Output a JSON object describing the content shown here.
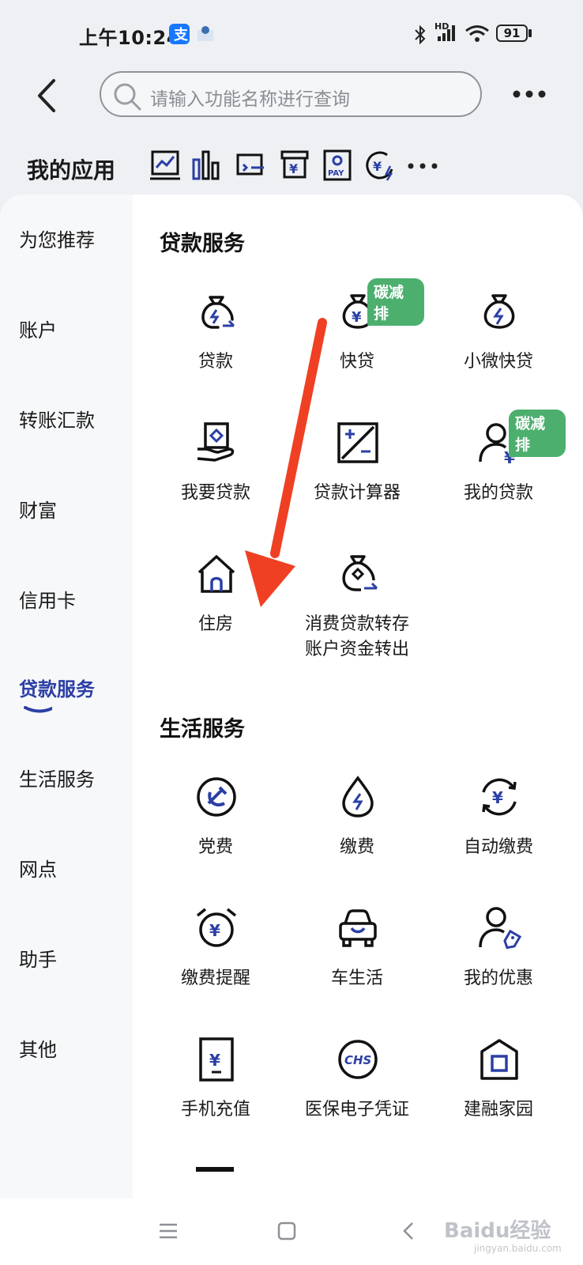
{
  "status_bar": {
    "time": "上午10:24",
    "network": "HD",
    "battery": "91"
  },
  "search": {
    "placeholder": "请输入功能名称进行查询"
  },
  "my_apps": {
    "title": "我的应用",
    "icons": [
      "trend-chart-icon",
      "bar-chart-icon",
      "card-transfer-icon",
      "yuan-box-icon",
      "pay-icon",
      "yuan-refresh-icon",
      "more-dots-icon"
    ]
  },
  "sidebar": {
    "items": [
      {
        "label": "为您推荐"
      },
      {
        "label": "账户"
      },
      {
        "label": "转账汇款"
      },
      {
        "label": "财富"
      },
      {
        "label": "信用卡"
      },
      {
        "label": "贷款服务",
        "active": true
      },
      {
        "label": "生活服务"
      },
      {
        "label": "网点"
      },
      {
        "label": "助手"
      },
      {
        "label": "其他"
      }
    ]
  },
  "sections": [
    {
      "title": "贷款服务",
      "tiles": [
        {
          "label": "贷款",
          "icon": "loan-bag-icon"
        },
        {
          "label": "快贷",
          "icon": "yuan-bag-icon",
          "badge": "碳减排"
        },
        {
          "label": "小微快贷",
          "icon": "lightning-bag-icon"
        },
        {
          "label": "我要贷款",
          "icon": "hand-document-icon"
        },
        {
          "label": "贷款计算器",
          "icon": "calculator-icon"
        },
        {
          "label": "我的贷款",
          "icon": "person-yuan-icon",
          "badge": "碳减排"
        },
        {
          "label": "住房",
          "icon": "house-icon"
        },
        {
          "label_line1": "消费贷款转存",
          "label_line2": "账户资金转出",
          "icon": "bag-transfer-icon"
        }
      ]
    },
    {
      "title": "生活服务",
      "tiles": [
        {
          "label": "党费",
          "icon": "party-emblem-icon"
        },
        {
          "label": "缴费",
          "icon": "water-drop-icon"
        },
        {
          "label": "自动缴费",
          "icon": "yuan-cycle-icon"
        },
        {
          "label": "缴费提醒",
          "icon": "alarm-clock-icon"
        },
        {
          "label": "车生活",
          "icon": "car-icon"
        },
        {
          "label": "我的优惠",
          "icon": "person-tag-icon"
        },
        {
          "label": "手机充值",
          "icon": "phone-yuan-icon"
        },
        {
          "label": "医保电子凭证",
          "icon": "chs-icon"
        },
        {
          "label": "建融家园",
          "icon": "home-square-icon"
        }
      ]
    }
  ],
  "watermark": {
    "text": "Baidu经验",
    "sub": "jingyan.baidu.com"
  },
  "colors": {
    "accent": "#2b3fa5",
    "badge": "#4caf6e",
    "arrow": "#ef4023"
  }
}
